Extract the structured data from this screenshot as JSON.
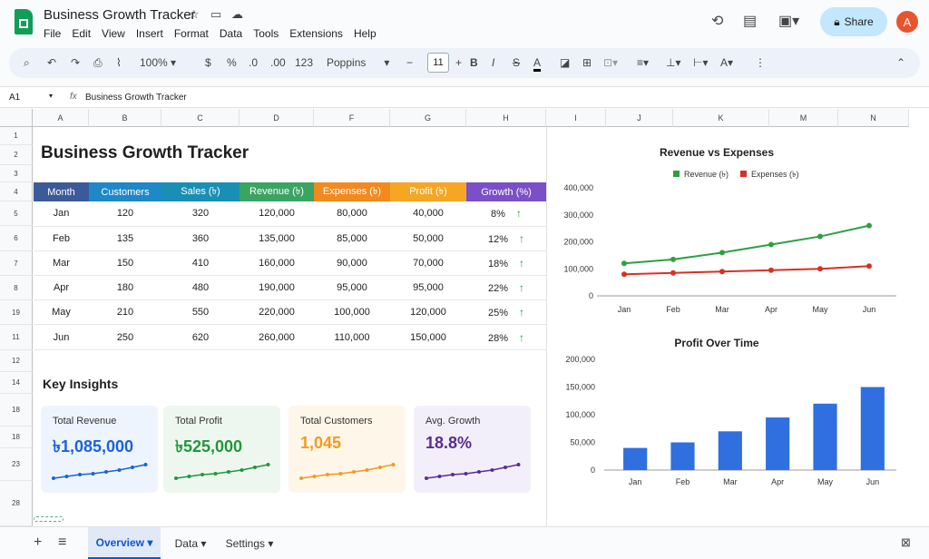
{
  "app": {
    "doc_title": "Business Growth Tracker",
    "menu": [
      "File",
      "Edit",
      "View",
      "Insert",
      "Format",
      "Data",
      "Tools",
      "Extensions",
      "Help"
    ],
    "share_label": "Share",
    "avatar_letter": "A"
  },
  "toolbar": {
    "zoom": "100%",
    "currency": "$",
    "percent": "%",
    "dec_decrease": ".0",
    "dec_increase": ".00",
    "number_format": "123",
    "font": "Poppins",
    "font_size": "11",
    "bold": "B",
    "italic": "I",
    "strike": "S",
    "text_color": "A"
  },
  "formula_bar": {
    "cell_ref": "A1",
    "fx": "fx",
    "content": "Business Growth Tracker"
  },
  "columns": [
    "A",
    "B",
    "C",
    "D",
    "F",
    "G",
    "H",
    "I",
    "J",
    "K",
    "M",
    "N"
  ],
  "row_numbers": [
    "1",
    "2",
    "3",
    "4",
    "5",
    "6",
    "7",
    "8",
    "19",
    "11",
    "12",
    "14",
    "18",
    "18",
    "23",
    "28"
  ],
  "sheet": {
    "title": "Business Growth Tracker",
    "table": {
      "headers": [
        "Month",
        "Customers",
        "Sales (৳)",
        "Revenue (৳)",
        "Expenses (৳)",
        "Profit (৳)",
        "Growth (%)"
      ],
      "header_colors": [
        "#3c5a99",
        "#1e88c8",
        "#1a8fb5",
        "#3aa563",
        "#f28a1e",
        "#f6a623",
        "#7b4fc8"
      ],
      "rows": [
        [
          "Jan",
          "120",
          "320",
          "120,000",
          "80,000",
          "40,000",
          "8%"
        ],
        [
          "Feb",
          "135",
          "360",
          "135,000",
          "85,000",
          "50,000",
          "12%"
        ],
        [
          "Mar",
          "150",
          "410",
          "160,000",
          "90,000",
          "70,000",
          "18%"
        ],
        [
          "Apr",
          "180",
          "480",
          "190,000",
          "95,000",
          "95,000",
          "22%"
        ],
        [
          "May",
          "210",
          "550",
          "220,000",
          "100,000",
          "120,000",
          "25%"
        ],
        [
          "Jun",
          "250",
          "620",
          "260,000",
          "110,000",
          "150,000",
          "28%"
        ]
      ],
      "up_icon": "↑"
    },
    "insights_title": "Key Insights",
    "cards": [
      {
        "label": "Total Revenue",
        "value": "৳1,085,000",
        "color": "#1a63d6",
        "bg": "#eef4fd"
      },
      {
        "label": "Total Profit",
        "value": "৳525,000",
        "color": "#23963d",
        "bg": "#eef7ef"
      },
      {
        "label": "Total Customers",
        "value": "1,045",
        "color": "#f39a1d",
        "bg": "#fef6e9"
      },
      {
        "label": "Avg. Growth",
        "value": "18.8%",
        "color": "#5a2d91",
        "bg": "#f3effa"
      }
    ]
  },
  "chart_data": [
    {
      "type": "line",
      "title": "Revenue vs Expenses",
      "categories": [
        "Jan",
        "Feb",
        "Mar",
        "Apr",
        "May",
        "Jun"
      ],
      "series": [
        {
          "name": "Revenue (৳)",
          "values": [
            120000,
            135000,
            160000,
            190000,
            220000,
            260000
          ],
          "color": "#2ea043"
        },
        {
          "name": "Expenses (৳)",
          "values": [
            80000,
            85000,
            90000,
            95000,
            100000,
            110000
          ],
          "color": "#d93025"
        }
      ],
      "yticks": [
        "0",
        "100,000",
        "200,000",
        "300,000",
        "400,000"
      ],
      "ylim": [
        0,
        400000
      ],
      "legend": "top"
    },
    {
      "type": "bar",
      "title": "Profit Over Time",
      "categories": [
        "Jan",
        "Feb",
        "Mar",
        "Apr",
        "May",
        "Jun"
      ],
      "values": [
        40000,
        50000,
        70000,
        95000,
        120000,
        150000
      ],
      "color": "#2f6fe0",
      "yticks": [
        "0",
        "50,000",
        "100,000",
        "150,000",
        "200,000"
      ],
      "ylim": [
        0,
        200000
      ]
    }
  ],
  "tabs": [
    "Overview",
    "Data",
    "Settings"
  ]
}
